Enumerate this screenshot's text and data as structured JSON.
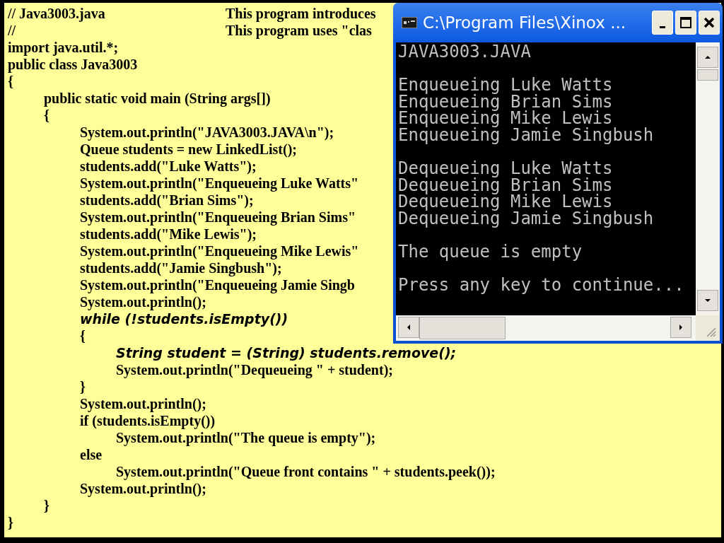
{
  "slide": {
    "code_lines": [
      {
        "kind": "plain",
        "text": "// Java3003.java",
        "note": "This program introduces"
      },
      {
        "kind": "plain",
        "text": "//",
        "note": "This program uses \"clas"
      },
      {
        "kind": "plain",
        "text": "import java.util.*;"
      },
      {
        "kind": "plain",
        "text": "public class Java3003"
      },
      {
        "kind": "plain",
        "text": "{",
        "children": [
          {
            "kind": "plain",
            "text": "public static void main (String args[])"
          },
          {
            "kind": "plain",
            "text": "{",
            "children": [
              {
                "kind": "plain",
                "text": "System.out.println(\"JAVA3003.JAVA\\n\");"
              },
              {
                "kind": "plain",
                "text": "Queue students = new LinkedList();"
              },
              {
                "kind": "plain",
                "text": "students.add(\"Luke Watts\");"
              },
              {
                "kind": "plain",
                "text": "System.out.println(\"Enqueueing Luke Watts\""
              },
              {
                "kind": "plain",
                "text": "students.add(\"Brian Sims\");"
              },
              {
                "kind": "plain",
                "text": "System.out.println(\"Enqueueing Brian Sims\""
              },
              {
                "kind": "plain",
                "text": "students.add(\"Mike Lewis\");"
              },
              {
                "kind": "plain",
                "text": "System.out.println(\"Enqueueing Mike Lewis\""
              },
              {
                "kind": "plain",
                "text": "students.add(\"Jamie Singbush\");"
              },
              {
                "kind": "plain",
                "text": "System.out.println(\"Enqueueing Jamie Singb"
              },
              {
                "kind": "plain",
                "text": "System.out.println();"
              },
              {
                "kind": "emphasis",
                "text": "while (!students.isEmpty())"
              },
              {
                "kind": "plain",
                "text": "{",
                "children": [
                  {
                    "kind": "emphasis",
                    "text": "String student = (String) students.remove();"
                  },
                  {
                    "kind": "plain",
                    "text": "System.out.println(\"Dequeueing \" + student);"
                  }
                ]
              },
              {
                "kind": "plain",
                "text": "}"
              },
              {
                "kind": "plain",
                "text": "System.out.println();"
              },
              {
                "kind": "plain",
                "text": "if (students.isEmpty())",
                "children": [
                  {
                    "kind": "plain",
                    "text": "System.out.println(\"The queue is empty\");"
                  }
                ]
              },
              {
                "kind": "plain",
                "text": "else",
                "children": [
                  {
                    "kind": "plain",
                    "text": "System.out.println(\"Queue front contains \" + students.peek());"
                  }
                ]
              },
              {
                "kind": "plain",
                "text": "System.out.println();"
              }
            ]
          },
          {
            "kind": "plain",
            "text": "}"
          }
        ]
      },
      {
        "kind": "plain",
        "text": "}"
      }
    ]
  },
  "console_window": {
    "title": "C:\\Program Files\\Xinox ...",
    "output_groups": [
      [
        "JAVA3003.JAVA"
      ],
      [
        "Enqueueing Luke Watts",
        "Enqueueing Brian Sims",
        "Enqueueing Mike Lewis",
        "Enqueueing Jamie Singbush"
      ],
      [
        "Dequeueing Luke Watts",
        "Dequeueing Brian Sims",
        "Dequeueing Mike Lewis",
        "Dequeueing Jamie Singbush"
      ],
      [
        "The queue is empty"
      ],
      [
        "Press any key to continue..."
      ]
    ]
  }
}
